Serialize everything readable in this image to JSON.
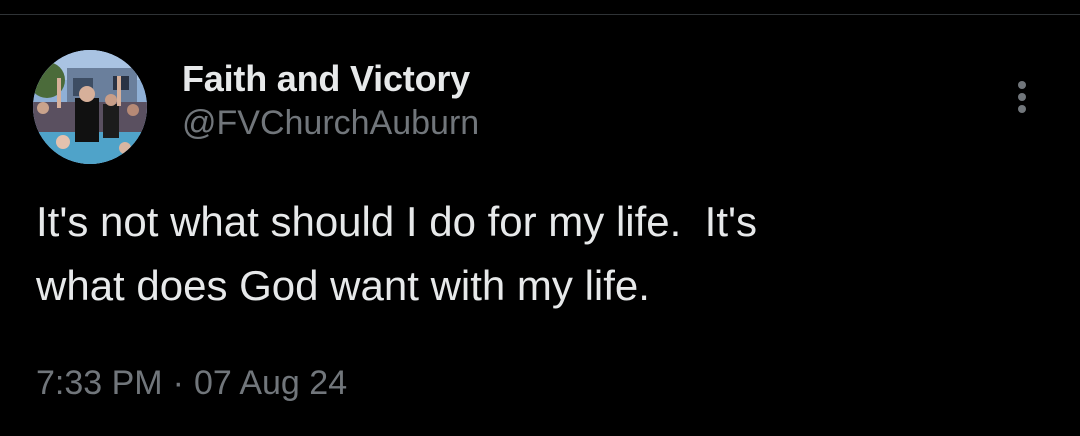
{
  "tweet": {
    "author": {
      "display_name": "Faith and Victory",
      "handle": "@FVChurchAuburn",
      "avatar_icon": "profile-photo"
    },
    "more_icon": "more-vertical-icon",
    "text": "It's not what should I do for my life.  It's\nwhat does God want with my life.",
    "time": "7:33 PM",
    "separator": "·",
    "date": "07 Aug 24"
  },
  "colors": {
    "background": "#000000",
    "primary_text": "#e7e9ea",
    "secondary_text": "#71767b",
    "divider": "#2f3336"
  }
}
